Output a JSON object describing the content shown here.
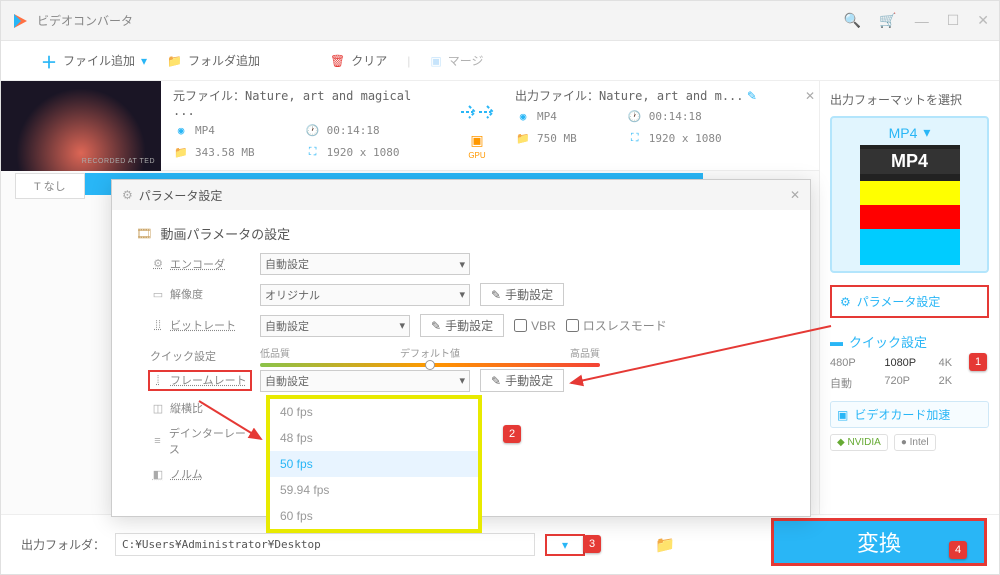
{
  "app": {
    "title": "ビデオコンバータ"
  },
  "toolbar": {
    "add_file": "ファイル追加",
    "add_folder": "フォルダ追加",
    "clear": "クリア",
    "merge": "マージ"
  },
  "subtabs": {
    "none": "なし"
  },
  "file": {
    "src_label": "元ファイル：",
    "src_name": "Nature, art and magical ...",
    "out_label": "出力ファイル：",
    "out_name": "Nature, art and m...",
    "src": {
      "format": "MP4",
      "duration": "00:14:18",
      "size": "343.58 MB",
      "resolution": "1920 x 1080"
    },
    "out": {
      "format": "MP4",
      "duration": "00:14:18",
      "size": "750 MB",
      "resolution": "1920 x 1080"
    },
    "gpu": "GPU"
  },
  "thumb": {
    "caption": "RECORDED AT TED"
  },
  "right": {
    "header": "出力フォーマットを選択",
    "format": "MP4",
    "param_btn": "パラメータ設定",
    "quick_hdr": "クイック設定",
    "res": [
      "480P",
      "1080P",
      "4K",
      "自動",
      "720P",
      "2K"
    ],
    "gpu_accel": "ビデオカード加速",
    "nvidia": "NVIDIA",
    "intel": "Intel"
  },
  "bottom": {
    "label": "出力フォルダ：",
    "path": "C:¥Users¥Administrator¥Desktop",
    "convert": "変換"
  },
  "modal": {
    "title": "パラメータ設定",
    "section": "動画パラメータの設定",
    "rows": {
      "encoder": "エンコーダ",
      "resolution": "解像度",
      "bitrate": "ビットレート",
      "quick": "クイック設定",
      "framerate": "フレームレート",
      "aspect": "縦横比",
      "deinterlace": "デインターレース",
      "norm": "ノルム"
    },
    "values": {
      "auto": "自動設定",
      "original": "オリジナル",
      "manual": "手動設定",
      "vbr": "VBR",
      "lossless": "ロスレスモード"
    },
    "quality": {
      "low": "低品質",
      "default": "デフォルト値",
      "high": "高品質"
    },
    "dropdown": [
      "40 fps",
      "48 fps",
      "50 fps",
      "59.94 fps",
      "60 fps"
    ]
  },
  "badges": {
    "b1": "1",
    "b2": "2",
    "b3": "3",
    "b4": "4"
  }
}
